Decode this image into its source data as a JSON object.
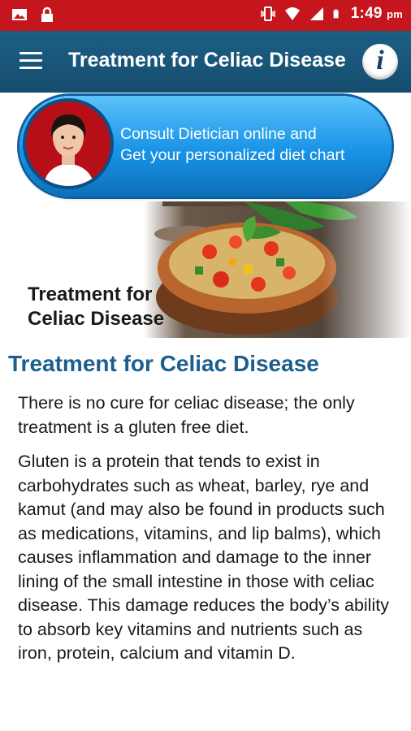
{
  "status_bar": {
    "time": "1:49",
    "ampm": "pm"
  },
  "app_bar": {
    "title": "Treatment for Celiac Disease",
    "info_label": "i"
  },
  "banner": {
    "line1": "Consult Dietician online and",
    "line2": "Get your personalized diet chart"
  },
  "hero": {
    "caption_line1": "Treatment for",
    "caption_line2": "Celiac Disease"
  },
  "article": {
    "heading": "Treatment for Celiac Disease",
    "paragraph1": "There is no cure for celiac disease; the only treatment is a gluten free diet.",
    "paragraph2": "Gluten is a protein that tends to exist in carbohydrates such as wheat, barley, rye and kamut (and may also be found in products such as medications, vitamins, and lip balms), which causes inflammation and damage to the inner lining of the small intestine in those with celiac disease. This damage reduces the body’s ability to absorb key vitamins and nutrients such as iron, protein, calcium and vitamin D."
  },
  "colors": {
    "status_bar": "#c4161c",
    "app_bar": "#1c5f85",
    "heading": "#1a5f8e",
    "banner": "#1893e6"
  }
}
